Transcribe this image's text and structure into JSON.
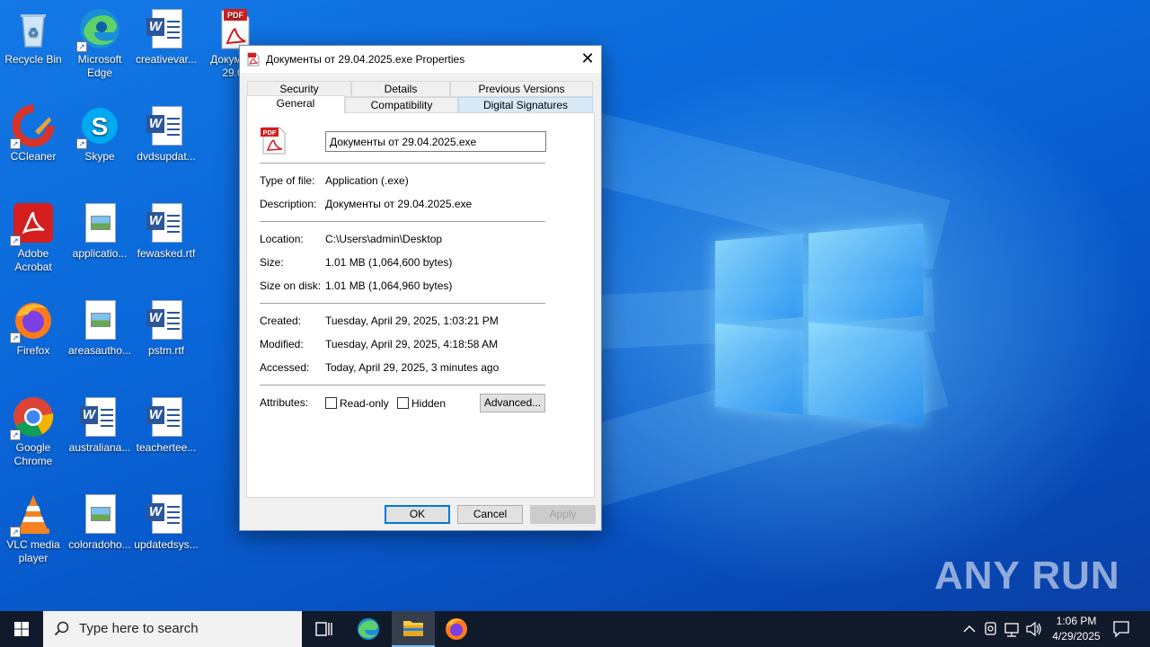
{
  "desktop": {
    "icons": [
      {
        "label": "Recycle Bin",
        "icon": "recycle-bin-icon"
      },
      {
        "label": "Microsoft Edge",
        "icon": "edge-icon"
      },
      {
        "label": "creativevar...",
        "icon": "word-doc-icon"
      },
      {
        "label": "Докум от 29.0",
        "icon": "pdf-exe-icon"
      },
      {
        "label": "CCleaner",
        "icon": "ccleaner-icon"
      },
      {
        "label": "Skype",
        "icon": "skype-icon"
      },
      {
        "label": "dvdsupdat...",
        "icon": "word-doc-icon"
      },
      {
        "label": "Adobe Acrobat",
        "icon": "acrobat-icon"
      },
      {
        "label": "applicatio...",
        "icon": "image-doc-icon"
      },
      {
        "label": "fewasked.rtf",
        "icon": "word-doc-icon"
      },
      {
        "label": "Firefox",
        "icon": "firefox-icon"
      },
      {
        "label": "areasautho...",
        "icon": "image-doc-icon"
      },
      {
        "label": "pstm.rtf",
        "icon": "word-doc-icon"
      },
      {
        "label": "Google Chrome",
        "icon": "chrome-icon"
      },
      {
        "label": "australiana...",
        "icon": "word-doc-icon"
      },
      {
        "label": "teachertee...",
        "icon": "word-doc-icon"
      },
      {
        "label": "VLC media player",
        "icon": "vlc-icon"
      },
      {
        "label": "coloradoho...",
        "icon": "image-doc-icon"
      },
      {
        "label": "updatedsys...",
        "icon": "word-doc-icon"
      }
    ],
    "watermark": "ANY RUN"
  },
  "dialog": {
    "title": "Документы от 29.04.2025.exe Properties",
    "tabs_row1": [
      "Security",
      "Details",
      "Previous Versions"
    ],
    "tabs_row2": [
      "General",
      "Compatibility",
      "Digital Signatures"
    ],
    "active_tab": "General",
    "file_name": "Документы от 29.04.2025.exe",
    "fields": {
      "type_label": "Type of file:",
      "type_value": "Application (.exe)",
      "description_label": "Description:",
      "description_value": "Документы от 29.04.2025.exe",
      "location_label": "Location:",
      "location_value": "C:\\Users\\admin\\Desktop",
      "size_label": "Size:",
      "size_value": "1.01 MB (1,064,600 bytes)",
      "size_on_disk_label": "Size on disk:",
      "size_on_disk_value": "1.01 MB (1,064,960 bytes)",
      "created_label": "Created:",
      "created_value": "Tuesday, April 29, 2025, 1:03:21 PM",
      "modified_label": "Modified:",
      "modified_value": "Tuesday, April 29, 2025, 4:18:58 AM",
      "accessed_label": "Accessed:",
      "accessed_value": "Today, April 29, 2025, 3 minutes ago",
      "attributes_label": "Attributes:"
    },
    "readonly_label": "Read-only",
    "hidden_label": "Hidden",
    "advanced_label": "Advanced...",
    "ok_label": "OK",
    "cancel_label": "Cancel",
    "apply_label": "Apply",
    "pdf_badge": "PDF"
  },
  "taskbar": {
    "search_placeholder": "Type here to search",
    "time": "1:06 PM",
    "date": "4/29/2025"
  },
  "colors": {
    "accent": "#0078d7",
    "taskbar": "#101a2a",
    "wallpaper": "#0a5fd6"
  }
}
